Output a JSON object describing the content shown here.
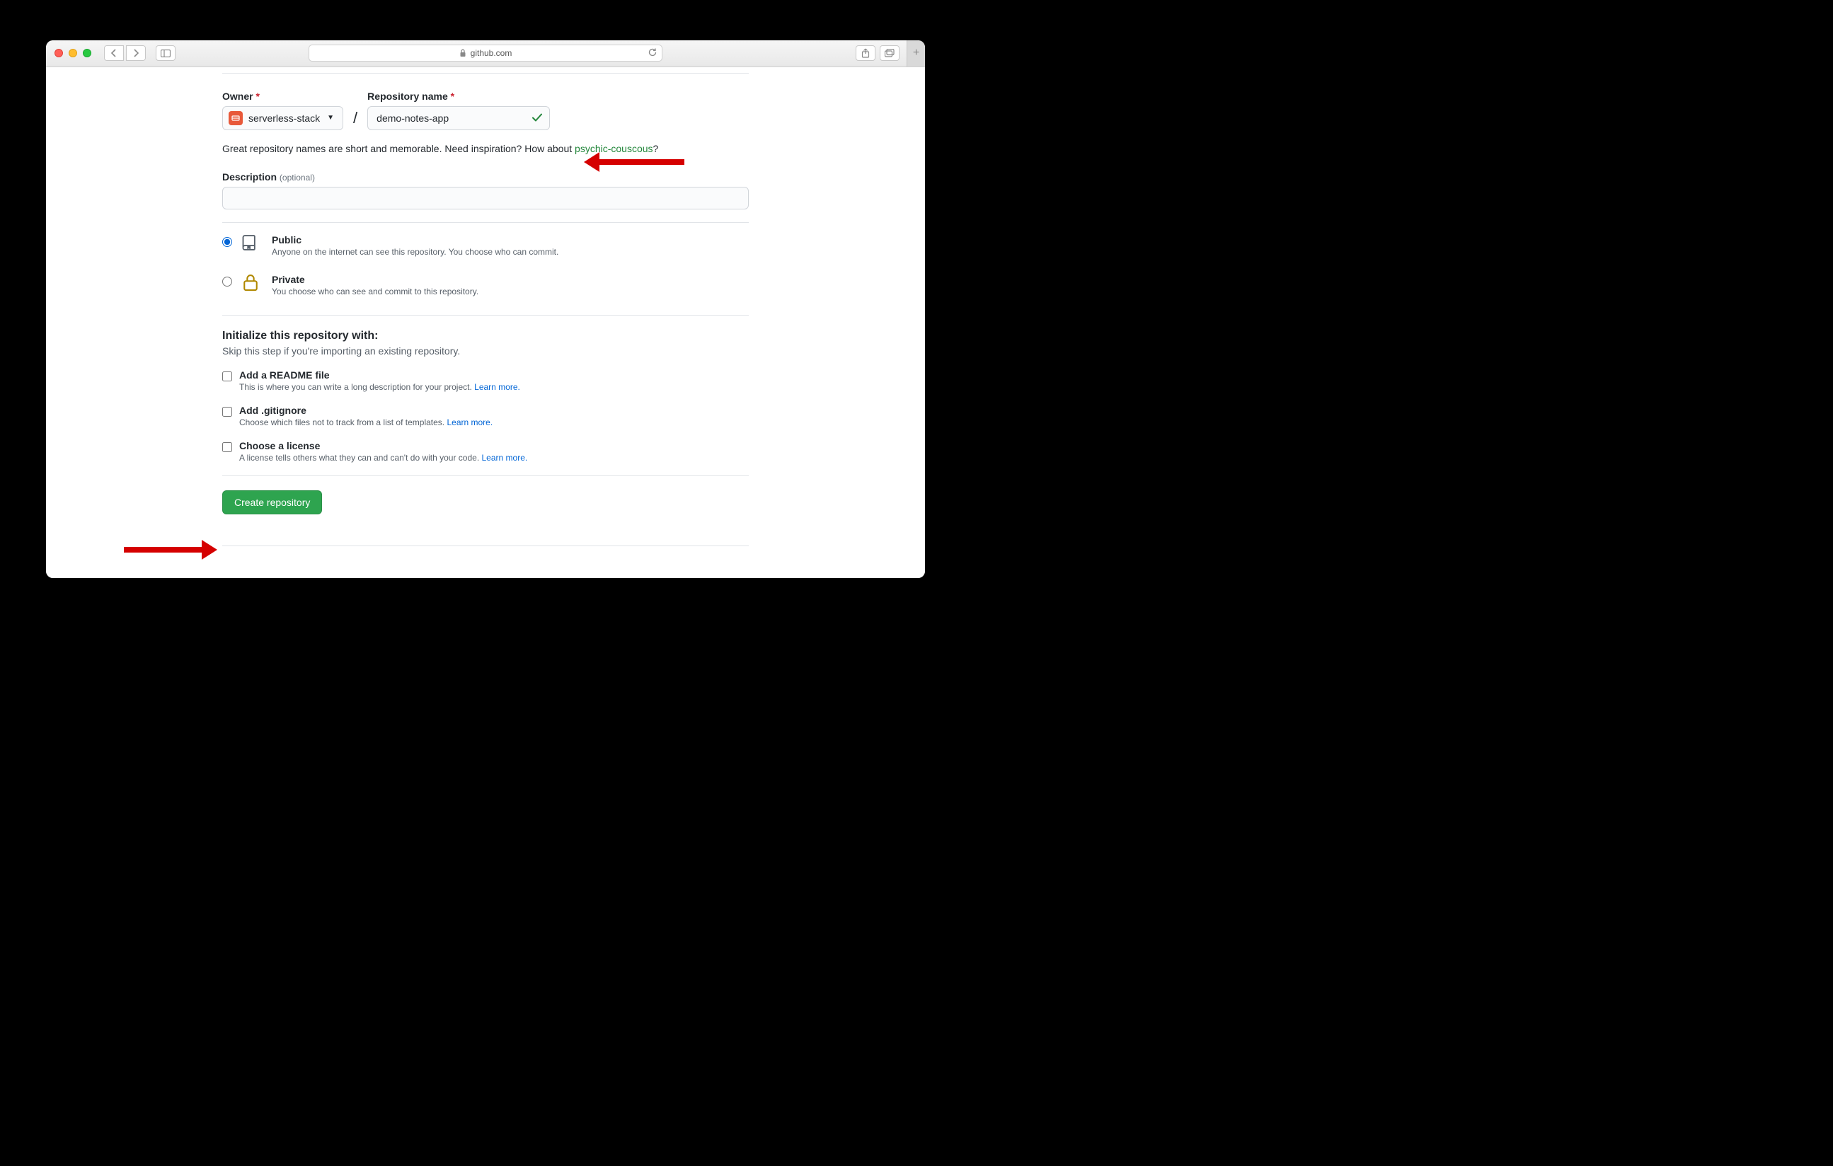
{
  "browser": {
    "url_host": "github.com"
  },
  "form": {
    "owner_label": "Owner",
    "owner_value": "serverless-stack",
    "repo_label": "Repository name",
    "repo_value": "demo-notes-app",
    "helper_prefix": "Great repository names are short and memorable. Need inspiration? How about ",
    "helper_suggestion": "psychic-couscous",
    "helper_suffix": "?",
    "desc_label": "Description",
    "desc_optional": "(optional)",
    "visibility": {
      "public": {
        "title": "Public",
        "desc": "Anyone on the internet can see this repository. You choose who can commit."
      },
      "private": {
        "title": "Private",
        "desc": "You choose who can see and commit to this repository."
      }
    },
    "init": {
      "title": "Initialize this repository with:",
      "sub": "Skip this step if you're importing an existing repository.",
      "readme": {
        "title": "Add a README file",
        "desc": "This is where you can write a long description for your project. ",
        "link": "Learn more."
      },
      "gitignore": {
        "title": "Add .gitignore",
        "desc": "Choose which files not to track from a list of templates. ",
        "link": "Learn more."
      },
      "license": {
        "title": "Choose a license",
        "desc": "A license tells others what they can and can't do with your code. ",
        "link": "Learn more."
      }
    },
    "submit_label": "Create repository"
  }
}
